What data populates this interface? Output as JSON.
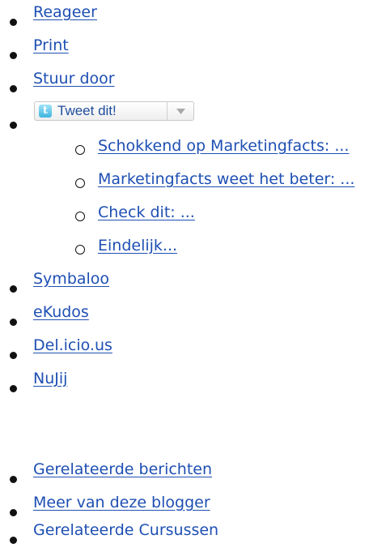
{
  "share_menu": {
    "items": [
      {
        "label": "Reageer"
      },
      {
        "label": "Print"
      },
      {
        "label": "Stuur door"
      }
    ],
    "tweet_button": {
      "logo_glyph": "t",
      "label": "Tweet dit!",
      "dropdown_icon": "chevron-down-icon",
      "options": [
        "Schokkend op Marketingfacts: ...",
        "Marketingfacts weet het beter: ...",
        "Check dit: ...",
        "Eindelijk..."
      ]
    },
    "bookmarks": [
      {
        "label": "Symbaloo"
      },
      {
        "label": "eKudos"
      },
      {
        "label": "Del.icio.us"
      },
      {
        "label": "NuJij"
      }
    ]
  },
  "related_menu": {
    "items": [
      {
        "label": "Gerelateerde berichten",
        "link": true
      },
      {
        "label": "Meer van deze blogger",
        "link": true
      },
      {
        "label": "Gerelateerde Cursussen",
        "link": false
      }
    ]
  },
  "colors": {
    "link": "#1e4fb3",
    "bullet": "#111111",
    "twitter_blue": "#3fb4e0"
  }
}
